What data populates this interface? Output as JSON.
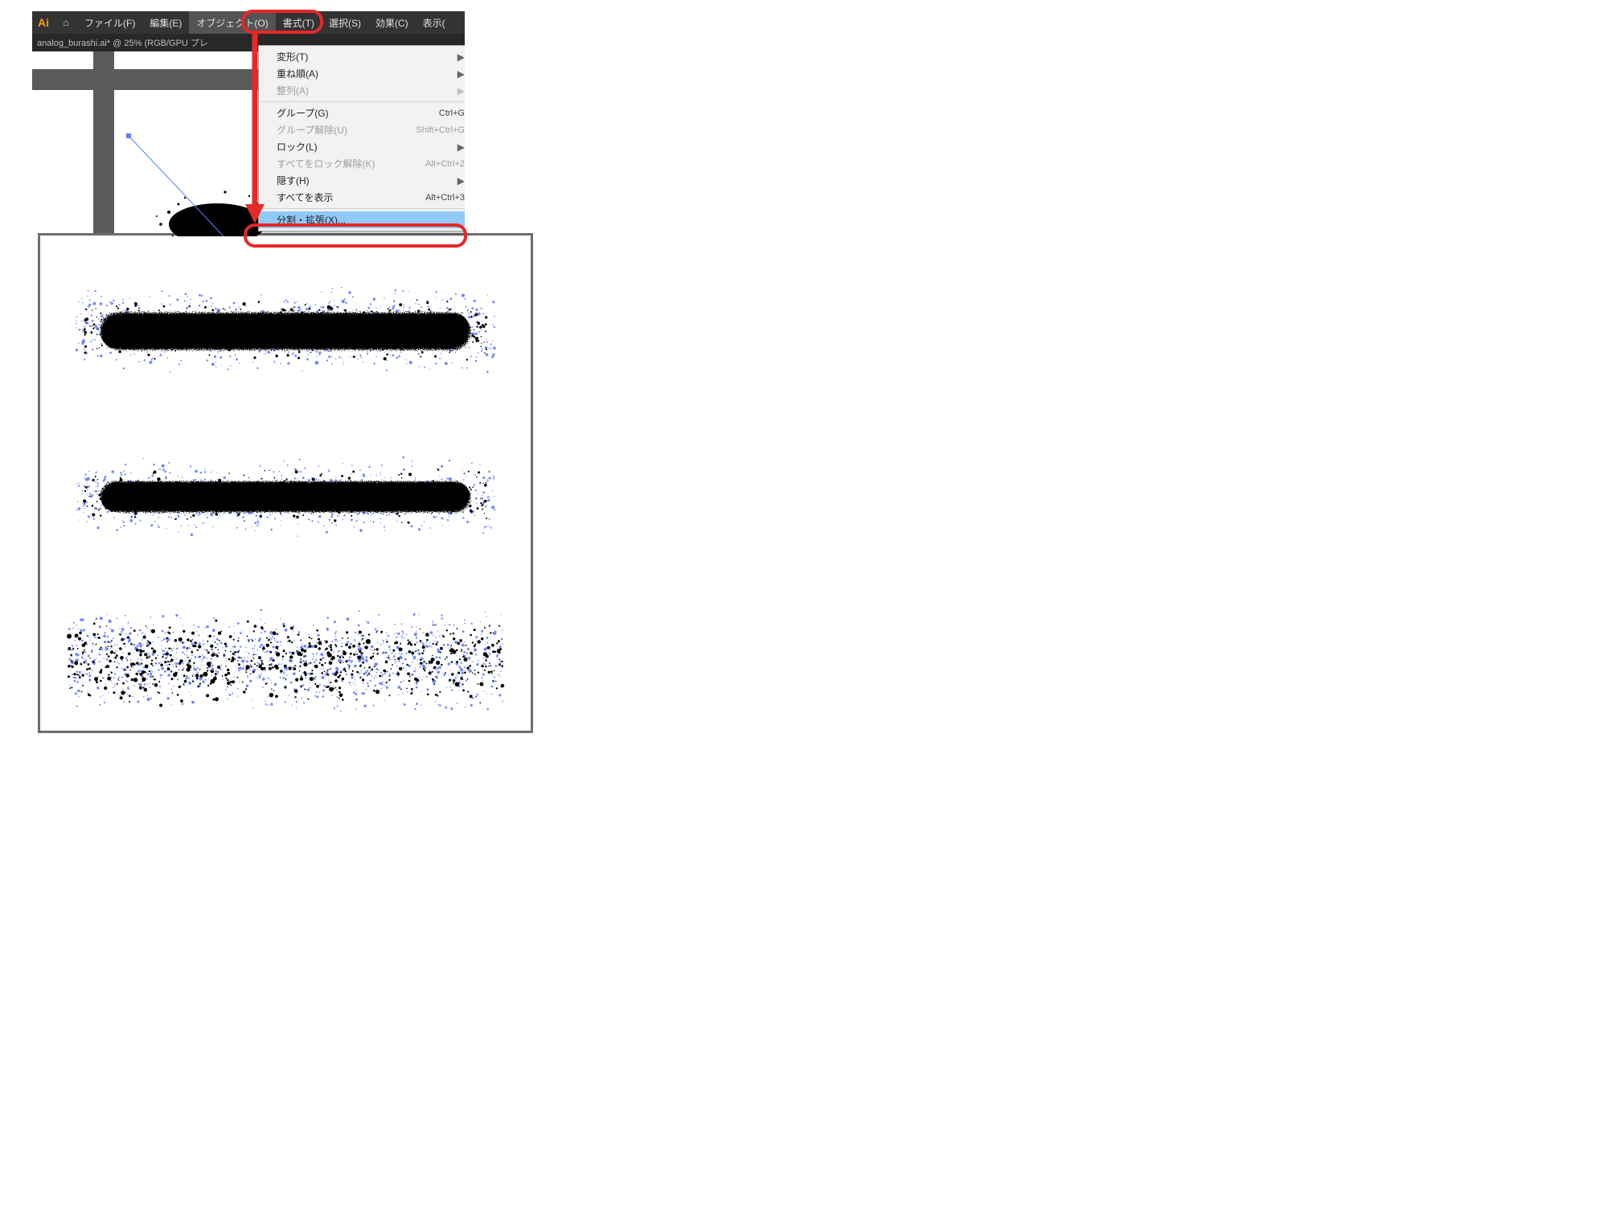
{
  "app": {
    "logo_text": "Ai",
    "home_glyph": "⌂"
  },
  "menu_bar": {
    "items": [
      {
        "label": "ファイル(F)"
      },
      {
        "label": "編集(E)"
      },
      {
        "label": "オブジェクト(O)",
        "open": true
      },
      {
        "label": "書式(T)"
      },
      {
        "label": "選択(S)"
      },
      {
        "label": "効果(C)"
      },
      {
        "label": "表示("
      }
    ]
  },
  "doc_tab": {
    "label": "analog_burashi.ai* @ 25% (RGB/GPU プレ"
  },
  "dropdown": {
    "items": [
      {
        "label": "変形(T)",
        "submenu": true
      },
      {
        "label": "重ね順(A)",
        "submenu": true
      },
      {
        "label": "整列(A)",
        "submenu": true,
        "disabled": true
      },
      {
        "sep": true
      },
      {
        "label": "グループ(G)",
        "shortcut": "Ctrl+G"
      },
      {
        "label": "グループ解除(U)",
        "shortcut": "Shift+Ctrl+G",
        "disabled": true
      },
      {
        "label": "ロック(L)",
        "submenu": true
      },
      {
        "label": "すべてをロック解除(K)",
        "shortcut": "Alt+Ctrl+2",
        "disabled": true
      },
      {
        "label": "隠す(H)",
        "submenu": true
      },
      {
        "label": "すべてを表示",
        "shortcut": "Alt+Ctrl+3"
      },
      {
        "sep": true
      },
      {
        "label": "分割・拡張(X)...",
        "selected": true
      }
    ]
  },
  "colors": {
    "highlight_blue": "#91c9f7",
    "annotation_red": "#e62828",
    "selection_blue": "#6b80ff",
    "spray_black": "#000000"
  }
}
